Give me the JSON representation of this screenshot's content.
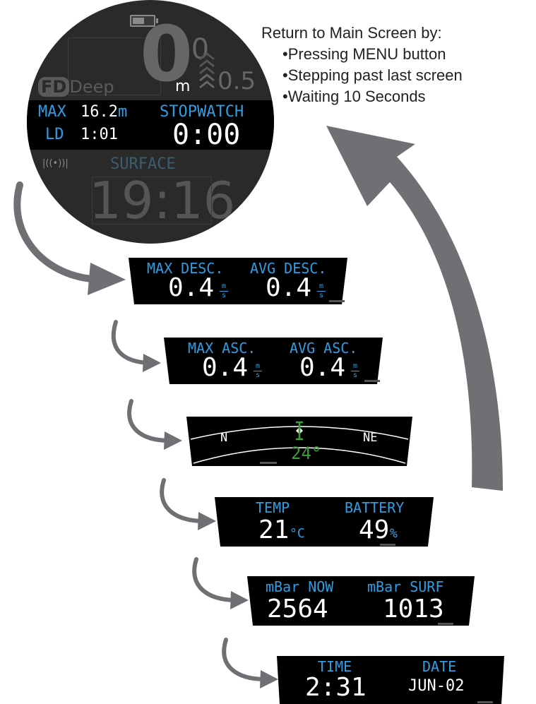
{
  "instructions": {
    "heading": "Return to Main Screen by:",
    "items": [
      "•Pressing MENU button",
      "•Stepping past last screen",
      "•Waiting 10 Seconds"
    ]
  },
  "main_screen": {
    "depth_value": "0",
    "depth_decimal": ".0",
    "depth_unit": "m",
    "ascent_rate": "0.5",
    "brand_fd": "FD",
    "brand_deep": "Deep",
    "max_label": "MAX",
    "max_value": "16.2",
    "max_unit": "m",
    "ld_label": "LD",
    "ld_value": "1:01",
    "stopwatch_label": "STOPWATCH",
    "stopwatch_value": "0:00",
    "surface_label": "SURFACE",
    "surface_time": "19:16"
  },
  "screens": {
    "descent": {
      "label_left": "MAX DESC.",
      "label_right": "AVG DESC.",
      "value_left": "0.4",
      "value_right": "0.4",
      "unit_num": "m",
      "unit_den": "s"
    },
    "ascent": {
      "label_left": "MAX ASC.",
      "label_right": "AVG ASC.",
      "value_left": "0.4",
      "value_right": "0.4",
      "unit_num": "m",
      "unit_den": "s"
    },
    "compass": {
      "dir_left": "N",
      "dir_right": "NE",
      "heading": "24°"
    },
    "temp_battery": {
      "label_left": "TEMP",
      "label_right": "BATTERY",
      "value_left": "21",
      "unit_left": "°C",
      "value_right": "49",
      "unit_right": "%"
    },
    "pressure": {
      "label_left": "mBar NOW",
      "label_right": "mBar SURF",
      "value_left": "2564",
      "value_right": "1013"
    },
    "time_date": {
      "label_left": "TIME",
      "label_right": "DATE",
      "value_left": "2:31",
      "value_right": "JUN-02"
    }
  },
  "colors": {
    "accent_blue": "#2e9de4",
    "compass_green": "#3aa03a",
    "arrow_gray": "#707074",
    "screen_black": "#000000"
  }
}
